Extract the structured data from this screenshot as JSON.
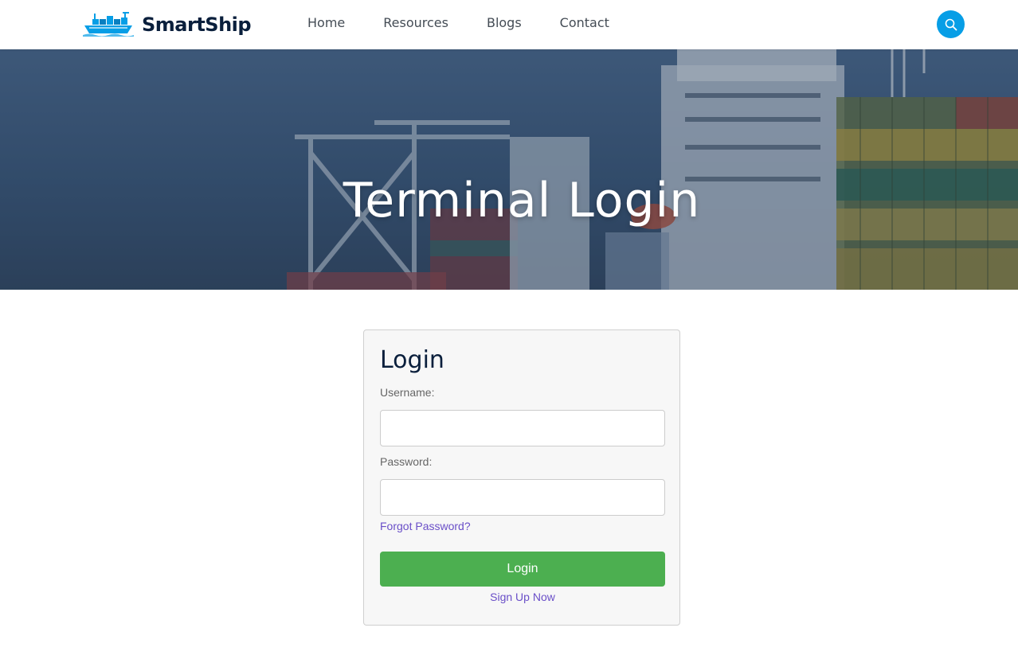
{
  "brand": {
    "name": "SmartShip",
    "logo_icon": "cargo-ship-icon",
    "accent": "#079ee6",
    "text_color": "#0a1f3c"
  },
  "nav": {
    "items": [
      "Home",
      "Resources",
      "Blogs",
      "Contact"
    ],
    "search_icon": "search-icon"
  },
  "hero": {
    "title": "Terminal Login"
  },
  "login": {
    "title": "Login",
    "username_label": "Username:",
    "username_value": "",
    "password_label": "Password:",
    "password_value": "",
    "forgot_link": "Forgot Password?",
    "submit_label": "Login",
    "signup_link": "Sign Up Now",
    "button_color": "#4caf50",
    "link_color": "#6a4fc8"
  }
}
